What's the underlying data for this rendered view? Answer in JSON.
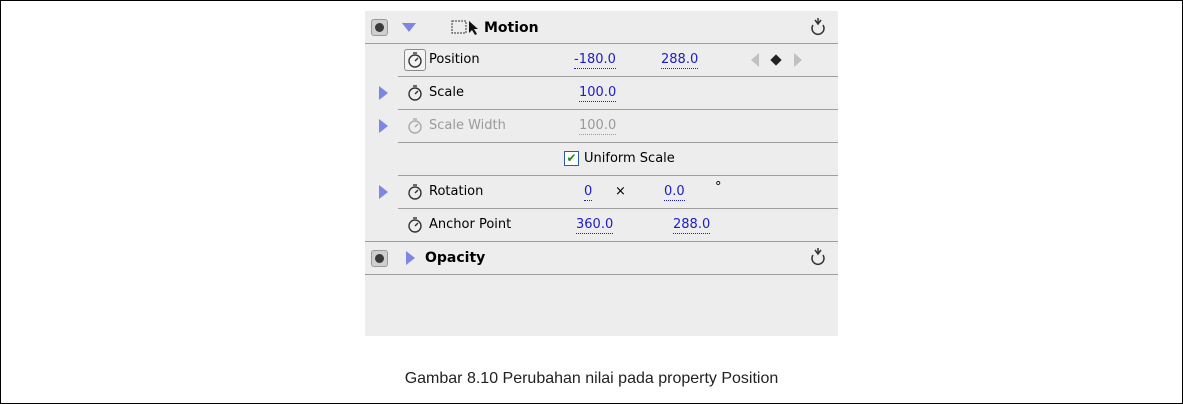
{
  "panel": {
    "motion": {
      "title": "Motion",
      "properties": {
        "position": {
          "label": "Position",
          "x": "-180.0",
          "y": "288.0"
        },
        "scale": {
          "label": "Scale",
          "value": "100.0"
        },
        "scale_width": {
          "label": "Scale Width",
          "value": "100.0"
        },
        "uniform_scale": {
          "label": "Uniform Scale",
          "checked": true,
          "check_glyph": "✔"
        },
        "rotation": {
          "label": "Rotation",
          "turns": "0",
          "times": "×",
          "degrees": "0.0",
          "degree_symbol": "°"
        },
        "anchor_point": {
          "label": "Anchor Point",
          "x": "360.0",
          "y": "288.0"
        }
      }
    },
    "opacity": {
      "title": "Opacity"
    }
  },
  "icons": {
    "toggle": "eye-toggle-icon",
    "stopwatch": "stopwatch-icon",
    "expand": "triangle-right-icon",
    "collapse": "triangle-down-icon",
    "reset": "reset-icon",
    "motion": "motion-icon",
    "keyframe_prev": "keyframe-prev-icon",
    "keyframe_add": "keyframe-add-icon",
    "keyframe_next": "keyframe-next-icon"
  },
  "colors": {
    "panel_bg": "#ededed",
    "value_blue": "#1c1cc8",
    "disabled": "#9a9a9a",
    "triangle": "#7d86e0"
  },
  "caption": "Gambar 8.10 Perubahan nilai pada property Position"
}
